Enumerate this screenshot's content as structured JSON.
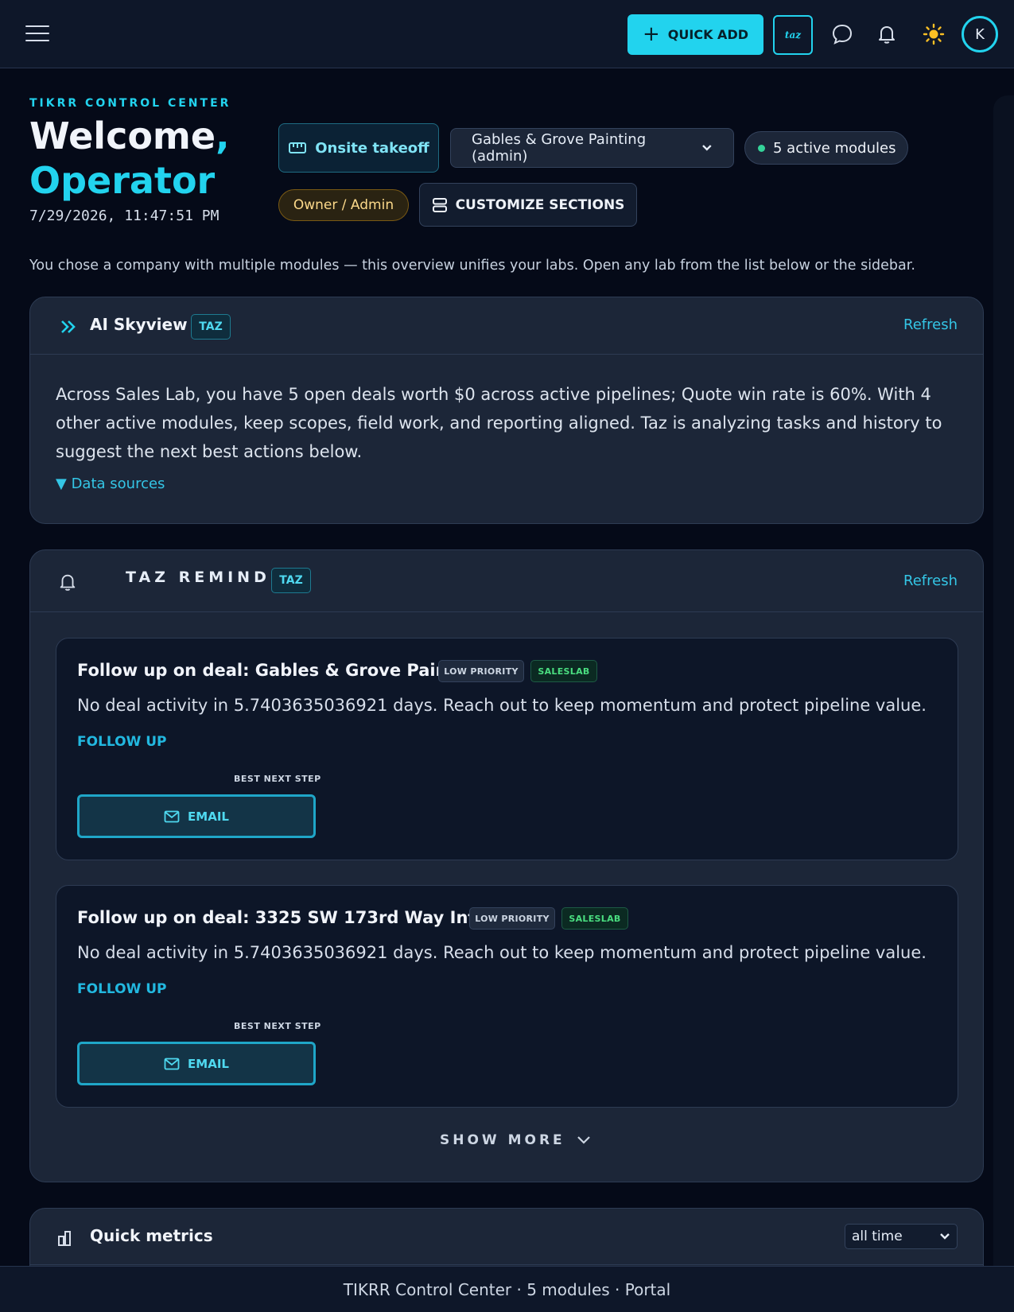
{
  "topbar": {
    "quick_add_label": "QUICK ADD",
    "taz_label": "taz",
    "avatar_initial": "K",
    "icons": [
      "menu-icon",
      "chat-icon",
      "bell-icon",
      "sun-icon"
    ],
    "accent_color": "#22d3ee"
  },
  "header": {
    "eyebrow": "TIKRR CONTROL CENTER",
    "welcome": "Welcome",
    "comma": ",",
    "name": "Operator",
    "datetime": "7/29/2026, 11:47:51 PM",
    "onsite_label": "Onsite takeoff",
    "company_select": "Gables & Grove Painting (admin)",
    "modules_pill": "5 active modules",
    "role": "Owner / Admin",
    "customize_label": "CUSTOMIZE SECTIONS",
    "intro": "You chose a company with multiple modules — this overview unifies your labs. Open any lab from the list below or the sidebar."
  },
  "skyview": {
    "title": "AI Skyview",
    "badge": "TAZ",
    "refresh": "Refresh",
    "text": "Across Sales Lab, you have 5 open deals worth $0 across active pipelines; Quote win rate is 60%. With 4 other active modules, keep scopes, field work, and reporting aligned. Taz is analyzing tasks and history to suggest the next best actions below.",
    "data_sources": "▼ Data sources"
  },
  "reminders": {
    "title": "TAZ REMINDERS",
    "badge": "TAZ",
    "refresh": "Refresh",
    "items": [
      {
        "title": "Follow up on deal: Gables & Grove Painting",
        "priority": "LOW PRIORITY",
        "module": "SALESLAB",
        "description": "No deal activity in 5.7403635036921 days. Reach out to keep momentum and protect pipeline value.",
        "action": "FOLLOW UP",
        "best_next": "BEST NEXT STEP",
        "email_label": "EMAIL"
      },
      {
        "title": "Follow up on deal: 3325 SW 173rd Way Interior",
        "priority": "LOW PRIORITY",
        "module": "SALESLAB",
        "description": "No deal activity in 5.7403635036921 days. Reach out to keep momentum and protect pipeline value.",
        "action": "FOLLOW UP",
        "best_next": "BEST NEXT STEP",
        "email_label": "EMAIL"
      }
    ],
    "show_more": "SHOW MORE"
  },
  "metrics": {
    "title": "Quick metrics",
    "range": "all time"
  },
  "footer": {
    "text": "TIKRR Control Center · 5 modules · Portal"
  }
}
